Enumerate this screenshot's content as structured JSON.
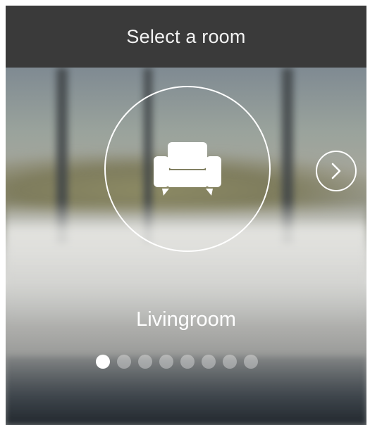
{
  "header": {
    "title": "Select a room"
  },
  "carousel": {
    "current_room": {
      "name": "Livingroom",
      "icon": "sofa-icon"
    },
    "next_button_icon": "chevron-right-icon",
    "page_count": 8,
    "current_page": 1
  }
}
